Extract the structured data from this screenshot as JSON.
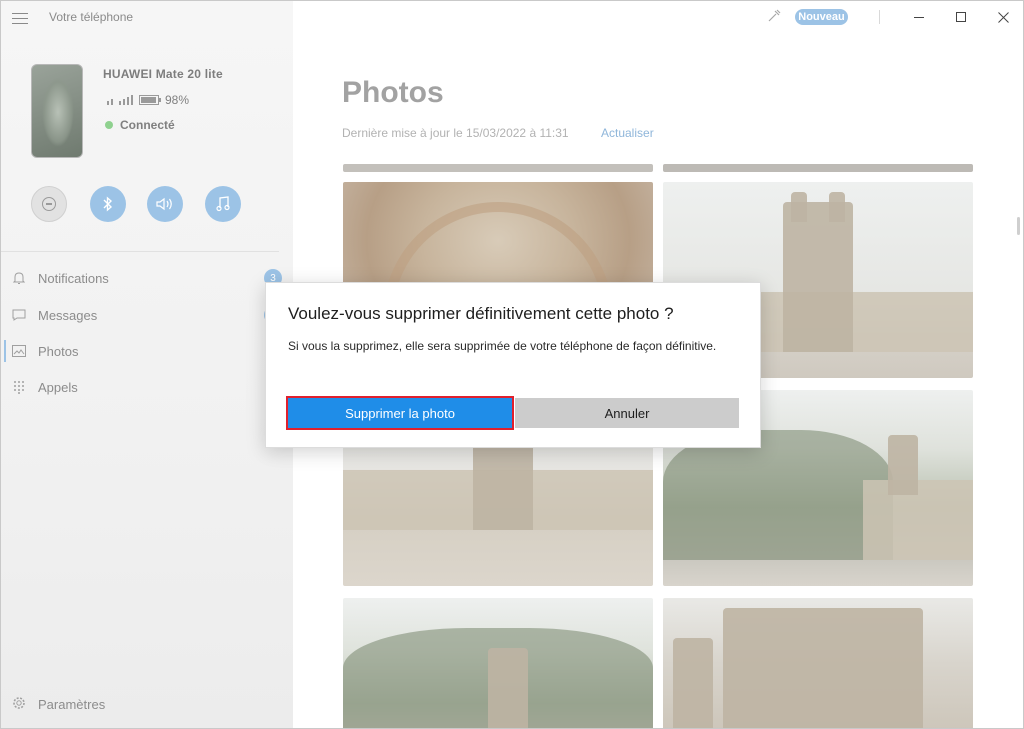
{
  "app": {
    "title": "Votre téléphone"
  },
  "titlebar": {
    "new_badge": "Nouveau"
  },
  "device": {
    "name": "HUAWEI Mate 20 lite",
    "battery": "98%",
    "status": "Connecté",
    "status_color": "#8fd18f"
  },
  "nav": {
    "items": [
      {
        "label": "Notifications",
        "badge": "3"
      },
      {
        "label": "Messages"
      },
      {
        "label": "Photos"
      },
      {
        "label": "Appels"
      }
    ],
    "settings": "Paramètres"
  },
  "main": {
    "title": "Photos",
    "updated": "Dernière mise à jour le 15/03/2022 à 11:31",
    "refresh": "Actualiser"
  },
  "dialog": {
    "title": "Voulez-vous supprimer définitivement cette photo ?",
    "body": "Si vous la supprimez, elle sera supprimée de votre téléphone de façon définitive.",
    "confirm": "Supprimer la photo",
    "cancel": "Annuler"
  },
  "colors": {
    "accent": "#1f8de8",
    "highlight": "#e0202d",
    "accent_faded": "#9cc3e6"
  }
}
